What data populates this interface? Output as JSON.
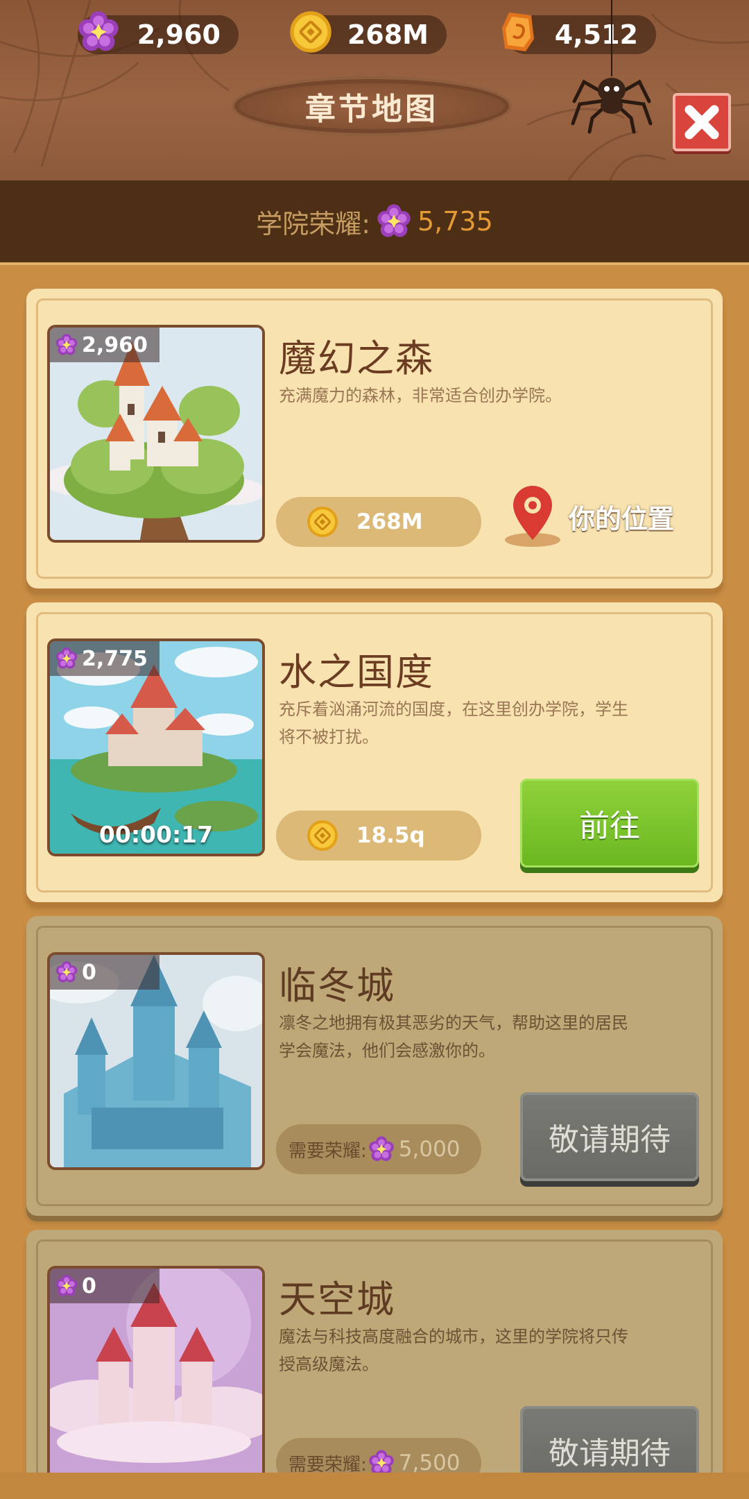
{
  "header": {
    "title": "章节地图",
    "resources": [
      {
        "icon": "purple-flower-icon",
        "value": "2,960"
      },
      {
        "icon": "gold-coin-icon",
        "value": "268M"
      },
      {
        "icon": "orange-rune-icon",
        "value": "4,512"
      }
    ]
  },
  "glory": {
    "label": "学院荣耀:",
    "value": "5,735"
  },
  "chapters": [
    {
      "title": "魔幻之森",
      "desc": "充满魔力的森林，非常适合创办学院。",
      "badge": "2,960",
      "cost": "268M",
      "status": "current",
      "location_label": "你的位置"
    },
    {
      "title": "水之国度",
      "desc": "充斥着汹涌河流的国度，在这里创办学院，学生将不被打扰。",
      "badge": "2,775",
      "timer": "00:00:17",
      "cost": "18.5q",
      "status": "available",
      "button": "前往"
    },
    {
      "title": "临冬城",
      "desc": "凛冬之地拥有极其恶劣的天气，帮助这里的居民学会魔法，他们会感激你的。",
      "badge": "0",
      "require_label": "需要荣耀:",
      "require_value": "5,000",
      "status": "locked",
      "button": "敬请期待"
    },
    {
      "title": "天空城",
      "desc": "魔法与科技高度融合的城市，这里的学院将只传授高级魔法。",
      "badge": "0",
      "require_label": "需要荣耀:",
      "require_value": "7,500",
      "status": "locked",
      "button": "敬请期待"
    }
  ],
  "colors": {
    "accent_green": "#6bb821",
    "glory_orange": "#e59a36",
    "card_bg": "#f7e2b0",
    "locked_bg": "#bfa877"
  }
}
